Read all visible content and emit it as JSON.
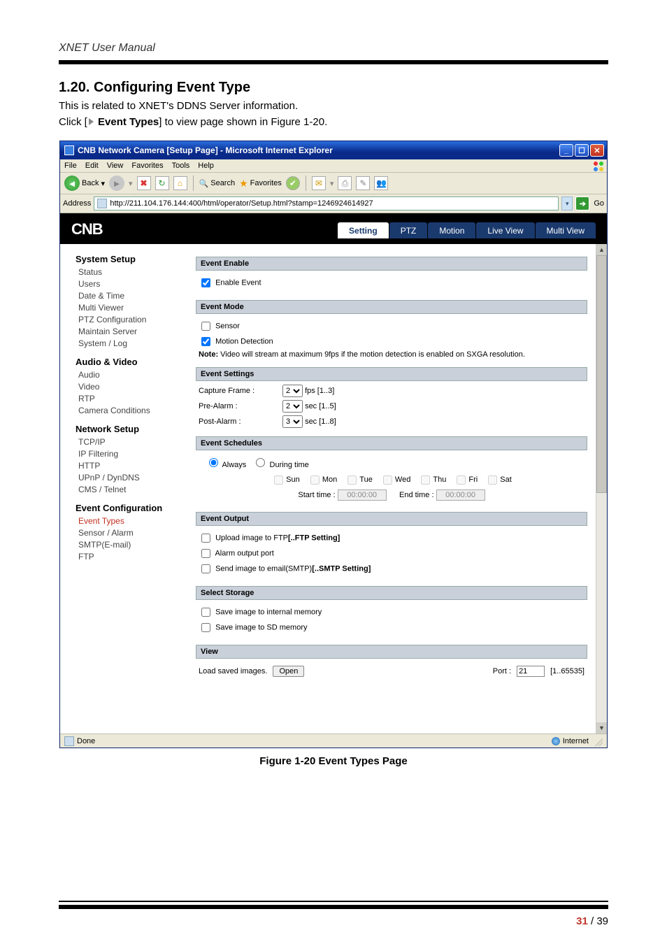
{
  "doc": {
    "running_header": "XNET User Manual",
    "page_current": "31",
    "page_sep": " / ",
    "page_total": "39",
    "section_title": "1.20. Configuring Event Type",
    "para1": "This is related to XNET's DDNS Server information.",
    "para2_a": "Click [",
    "para2_b": "Event Types",
    "para2_c": "] to view page shown in Figure 1-20.",
    "fig_caption": "Figure 1-20 Event Types Page"
  },
  "ie": {
    "title": "CNB Network Camera [Setup Page] - Microsoft Internet Explorer",
    "minimize": "_",
    "maximize": "☐",
    "close": "✕",
    "menu": {
      "file": "File",
      "edit": "Edit",
      "view": "View",
      "favorites": "Favorites",
      "tools": "Tools",
      "help": "Help"
    },
    "tb": {
      "back": "Back",
      "search": "Search",
      "favorites": "Favorites"
    },
    "addr": {
      "label": "Address",
      "url": "http://211.104.176.144:400/html/operator/Setup.html?stamp=1246924614927",
      "go": "Go"
    },
    "status": {
      "done": "Done",
      "internet": "Internet"
    }
  },
  "cnb": {
    "logo": "CNB",
    "tabs": {
      "setting": "Setting",
      "ptz": "PTZ",
      "motion": "Motion",
      "live": "Live View",
      "multi": "Multi View"
    }
  },
  "sidebar": {
    "g1": "System Setup",
    "g1_items": [
      "Status",
      "Users",
      "Date & Time",
      "Multi Viewer",
      "PTZ Configuration",
      "Maintain Server",
      "System / Log"
    ],
    "g2": "Audio & Video",
    "g2_items": [
      "Audio",
      "Video",
      "RTP",
      "Camera Conditions"
    ],
    "g3": "Network Setup",
    "g3_items": [
      "TCP/IP",
      "IP Filtering",
      "HTTP",
      "UPnP / DynDNS",
      "CMS / Telnet"
    ],
    "g4": "Event Configuration",
    "g4_items": [
      "Event Types",
      "Sensor / Alarm",
      "SMTP(E-mail)",
      "FTP"
    ]
  },
  "panel": {
    "enable_head": "Event Enable",
    "enable_cb": "Enable Event",
    "mode_head": "Event Mode",
    "mode_sensor": "Sensor",
    "mode_motion": "Motion Detection",
    "mode_note_a": "Note:",
    "mode_note_b": " Video will stream at maximum 9fps if the motion detection is enabled on SXGA resolution.",
    "settings_head": "Event Settings",
    "capture_label": "Capture Frame :",
    "capture_val": "2",
    "capture_unit": " fps [1..3]",
    "prealarm_label": "Pre-Alarm :",
    "prealarm_val": "2",
    "prealarm_unit": " sec [1..5]",
    "postalarm_label": "Post-Alarm :",
    "postalarm_val": "3",
    "postalarm_unit": " sec [1..8]",
    "sched_head": "Event Schedules",
    "sched_always": "Always",
    "sched_during": "During time",
    "days": {
      "sun": "Sun",
      "mon": "Mon",
      "tue": "Tue",
      "wed": "Wed",
      "thu": "Thu",
      "fri": "Fri",
      "sat": "Sat"
    },
    "start_label": "Start time :",
    "start_val": "00:00:00",
    "end_label": "End time :",
    "end_val": "00:00:00",
    "output_head": "Event Output",
    "out_ftp_a": "Upload image to FTP",
    "out_ftp_b": "[..FTP Setting]",
    "out_alarm": "Alarm output port",
    "out_smtp_a": "Send image to email(SMTP)",
    "out_smtp_b": "[..SMTP Setting]",
    "storage_head": "Select Storage",
    "st_internal": "Save image to internal memory",
    "st_sd": "Save image to SD memory",
    "view_head": "View",
    "view_load": "Load saved images.",
    "view_open": "Open",
    "view_port_label": "Port :",
    "view_port_val": "21",
    "view_port_range": "[1..65535]"
  }
}
